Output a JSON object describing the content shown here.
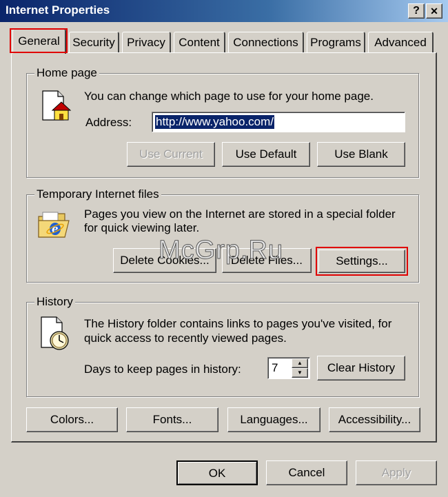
{
  "window": {
    "title": "Internet Properties",
    "help_button": "?",
    "close_button": "✕"
  },
  "tabs": [
    {
      "label": "General",
      "active": true
    },
    {
      "label": "Security"
    },
    {
      "label": "Privacy"
    },
    {
      "label": "Content"
    },
    {
      "label": "Connections"
    },
    {
      "label": "Programs"
    },
    {
      "label": "Advanced"
    }
  ],
  "home_page": {
    "legend": "Home page",
    "description": "You can change which page to use for your home page.",
    "address_label": "Address:",
    "address_value": "http://www.yahoo.com/",
    "use_current": "Use Current",
    "use_default": "Use Default",
    "use_blank": "Use Blank",
    "icon": "home-page-icon"
  },
  "temp_files": {
    "legend": "Temporary Internet files",
    "description_line1": "Pages you view on the Internet are stored in a special folder",
    "description_line2": "for quick viewing later.",
    "delete_cookies": "Delete Cookies...",
    "delete_files": "Delete Files...",
    "settings": "Settings...",
    "icon": "ie-folder-icon"
  },
  "history": {
    "legend": "History",
    "description_line1": "The History folder contains links to pages you've visited, for",
    "description_line2": "quick access to recently viewed pages.",
    "days_label": "Days to keep pages in history:",
    "days_value": "7",
    "clear_history": "Clear History",
    "icon": "history-clock-icon"
  },
  "bottom_buttons": {
    "colors": "Colors...",
    "fonts": "Fonts...",
    "languages": "Languages...",
    "accessibility": "Accessibility..."
  },
  "dialog_buttons": {
    "ok": "OK",
    "cancel": "Cancel",
    "apply": "Apply"
  },
  "watermark": "McGrp.Ru",
  "colors": {
    "highlight_red": "#e00000",
    "selection_blue": "#0a246a",
    "titlebar": "#0a246a"
  }
}
